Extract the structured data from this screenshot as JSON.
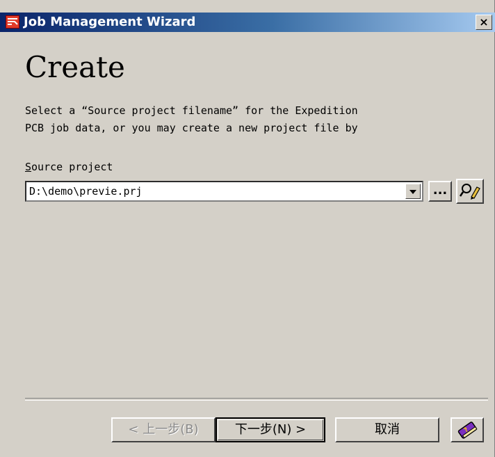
{
  "window": {
    "title": "Job Management Wizard",
    "close_label": "×"
  },
  "page": {
    "heading": "Create",
    "description": "Select a “Source project filename” for the Expedition\nPCB job data, or you may create a new project file by"
  },
  "source_project": {
    "label_mnemonic": "S",
    "label_rest": "ource project",
    "value": "D:\\demo\\previe.prj",
    "browse_label": "..."
  },
  "buttons": {
    "back_label": "< 上一步(B)",
    "next_label": "下一步(N) >",
    "cancel_label": "取消"
  },
  "icons": {
    "app": "wizard-app-icon",
    "dropdown": "chevron-down-icon",
    "search": "magnifier-pencil-icon",
    "help": "help-book-icon"
  }
}
